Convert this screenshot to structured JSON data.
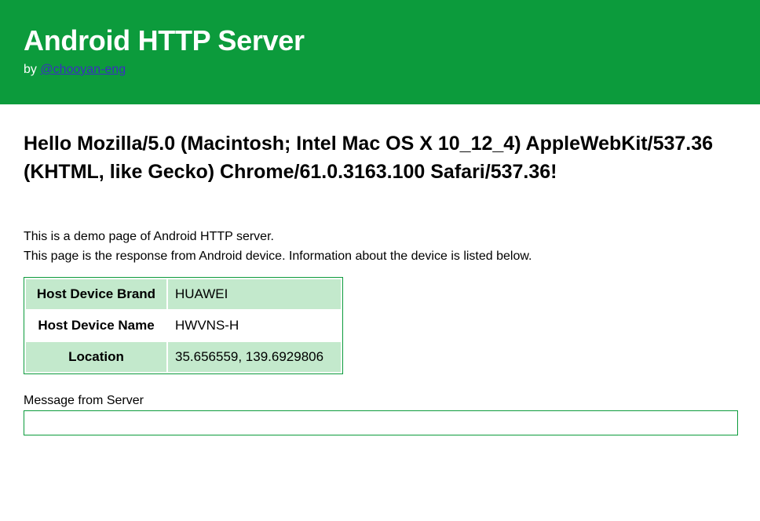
{
  "header": {
    "title": "Android HTTP Server",
    "by_prefix": "by ",
    "author_link": "@chooyan-eng",
    "background_color": "#0c9b3c"
  },
  "greeting": "Hello Mozilla/5.0 (Macintosh; Intel Mac OS X 10_12_4) AppleWebKit/537.36 (KHTML, like Gecko) Chrome/61.0.3163.100 Safari/537.36!",
  "description": {
    "line1": "This is a demo page of Android HTTP server.",
    "line2": "This page is the response from Android device. Information about the device is listed below."
  },
  "device_table": {
    "rows": [
      {
        "label": "Host Device Brand",
        "value": "HUAWEI"
      },
      {
        "label": "Host Device Name",
        "value": "HWVNS-H"
      },
      {
        "label": "Location",
        "value": "35.656559, 139.6929806"
      }
    ],
    "shade_color": "#c3e9cc"
  },
  "message": {
    "label": "Message from Server",
    "value": ""
  }
}
